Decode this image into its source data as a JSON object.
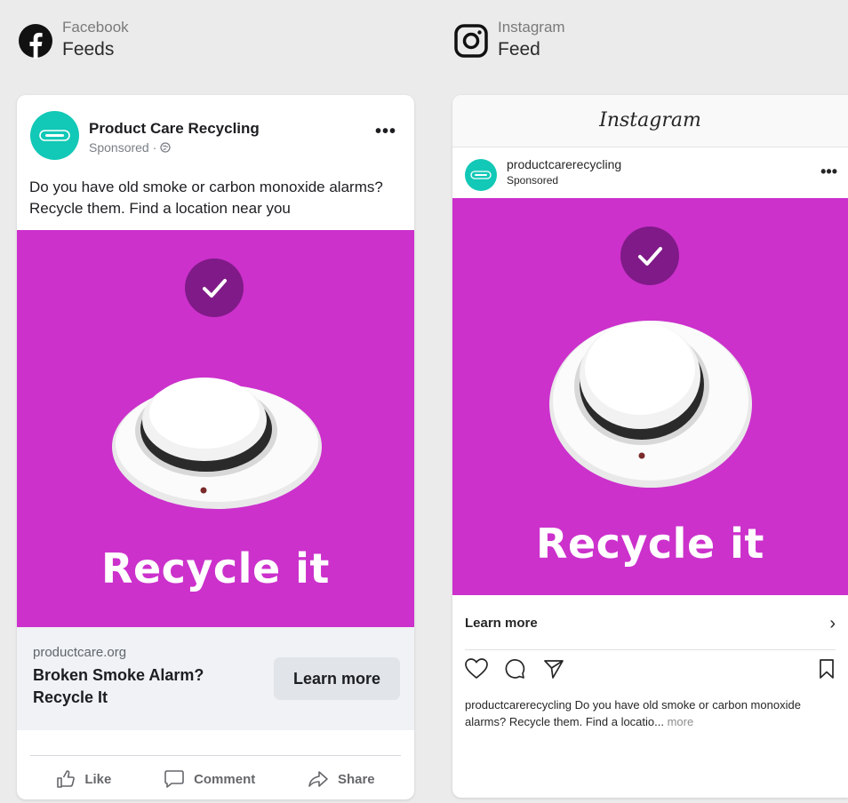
{
  "facebook": {
    "platform": "Facebook",
    "placement": "Feeds",
    "page_name": "Product Care Recycling",
    "sponsored": "Sponsored · ",
    "more": "•••",
    "primary_text": "Do you have old smoke or carbon monoxide alarms? Recycle them. Find a location near you",
    "image_text": "Recycle it",
    "domain": "productcare.org",
    "headline": "Broken Smoke Alarm? Recycle It",
    "cta": "Learn more",
    "actions": {
      "like": "Like",
      "comment": "Comment",
      "share": "Share"
    }
  },
  "instagram": {
    "platform": "Instagram",
    "placement": "Feed",
    "logo_text": "Instagram",
    "username": "productcarerecycling",
    "sponsored": "Sponsored",
    "more": "•••",
    "image_text": "Recycle it",
    "cta": "Learn more",
    "chevron": "›",
    "caption_user": "productcarerecycling",
    "caption_text": " Do you have old smoke or carbon monoxide alarms? Recycle them. Find a locatio...",
    "caption_more": " more"
  },
  "colors": {
    "ad_background": "#cc31cc",
    "check_circle": "#801a88",
    "avatar": "#12c8b6",
    "page_background": "#ebebeb"
  }
}
